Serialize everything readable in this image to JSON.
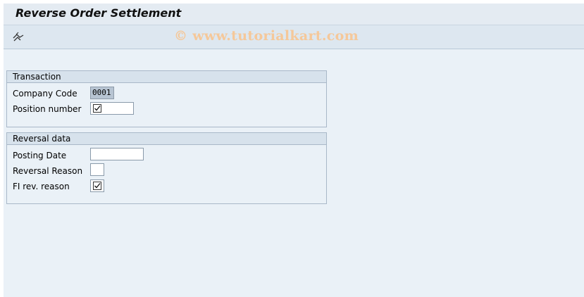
{
  "window": {
    "title": "Reverse Order Settlement"
  },
  "toolbar": {
    "execute_icon": "execute-icon",
    "watermark": "© www.tutorialkart.com"
  },
  "transaction_group": {
    "title": "Transaction",
    "company_code_label": "Company Code",
    "company_code_value": "0001",
    "position_number_label": "Position number",
    "position_number_checked": true
  },
  "reversal_group": {
    "title": "Reversal data",
    "posting_date_label": "Posting Date",
    "posting_date_value": "",
    "reversal_reason_label": "Reversal Reason",
    "reversal_reason_value": "",
    "fi_rev_reason_label": "FI rev. reason",
    "fi_rev_reason_checked": true
  }
}
